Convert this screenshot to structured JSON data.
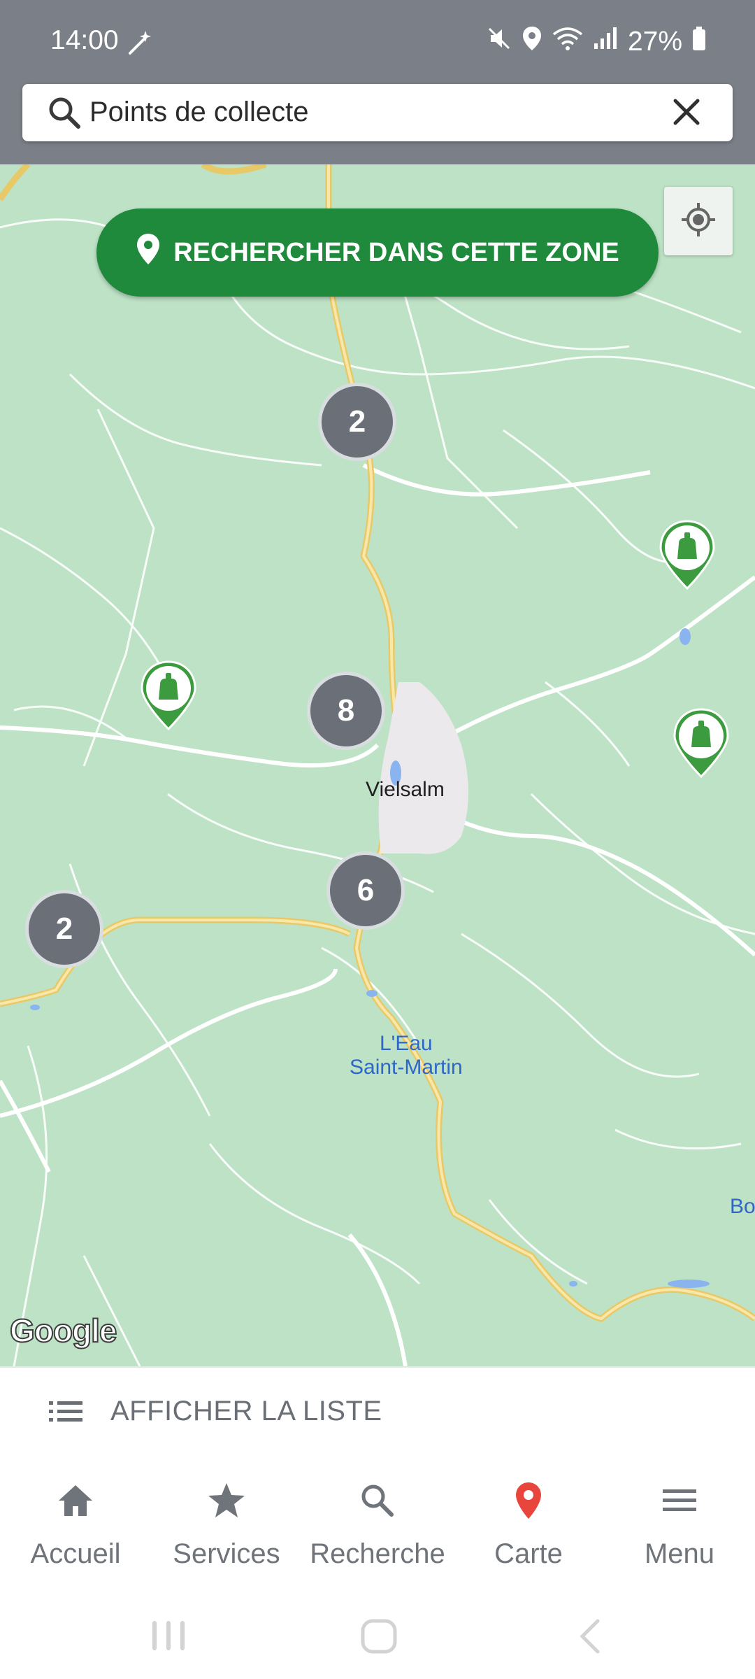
{
  "status_bar": {
    "time": "14:00",
    "battery": "27%",
    "icons": [
      "magic-wand-icon",
      "mute-icon",
      "location-icon",
      "wifi-icon",
      "signal-icon",
      "battery-icon"
    ]
  },
  "search": {
    "value": "Points de collecte",
    "icon": "search-icon",
    "clear_icon": "close-icon"
  },
  "map": {
    "search_area_button": "RECHERCHER DANS CETTE ZONE",
    "clusters": [
      "2",
      "8",
      "6",
      "2"
    ],
    "labels": {
      "town": "Vielsalm",
      "water_line1": "L'Eau",
      "water_line2": "Saint-Martin",
      "edge": "Bos"
    },
    "attribution": "Google",
    "colors": {
      "land": "#bde2c5",
      "road_major": "#f3d27a",
      "accent": "#1f8a3c",
      "cluster": "#6b7078"
    }
  },
  "list_bar": {
    "label": "AFFICHER LA LISTE",
    "icon": "list-icon"
  },
  "bottom_nav": {
    "items": [
      {
        "label": "Accueil",
        "icon": "home-icon"
      },
      {
        "label": "Services",
        "icon": "star-icon"
      },
      {
        "label": "Recherche",
        "icon": "search-icon"
      },
      {
        "label": "Carte",
        "icon": "map-pin-icon",
        "active": true
      },
      {
        "label": "Menu",
        "icon": "menu-icon"
      }
    ]
  },
  "system_nav": {
    "buttons": [
      "recents-icon",
      "home-icon",
      "back-icon"
    ]
  }
}
